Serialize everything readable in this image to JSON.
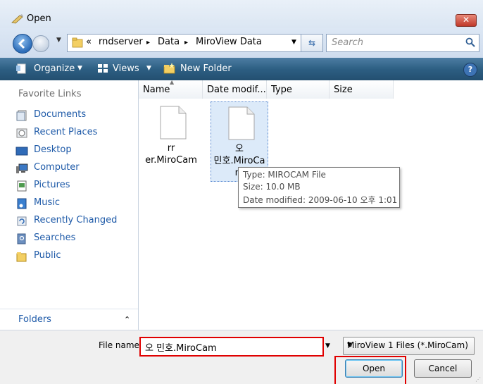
{
  "window": {
    "title": "Open",
    "close_glyph": "✕"
  },
  "address": {
    "overflow": "«",
    "crumbs": [
      "rndserver",
      "Data",
      "MiroView Data"
    ],
    "separator": "▸",
    "search_placeholder": "Search"
  },
  "toolbar": {
    "organize": "Organize",
    "views": "Views",
    "new_folder": "New Folder",
    "help": "?"
  },
  "sidebar": {
    "favorites_title": "Favorite Links",
    "items": [
      {
        "label": "Documents",
        "icon": "documents-icon"
      },
      {
        "label": "Recent Places",
        "icon": "recent-places-icon"
      },
      {
        "label": "Desktop",
        "icon": "desktop-icon"
      },
      {
        "label": "Computer",
        "icon": "computer-icon"
      },
      {
        "label": "Pictures",
        "icon": "pictures-icon"
      },
      {
        "label": "Music",
        "icon": "music-icon"
      },
      {
        "label": "Recently Changed",
        "icon": "recently-changed-icon"
      },
      {
        "label": "Searches",
        "icon": "searches-icon"
      },
      {
        "label": "Public",
        "icon": "public-folder-icon"
      }
    ],
    "folders_label": "Folders",
    "folders_chevron": "⌃"
  },
  "columns": [
    "Name",
    "Date modif...",
    "Type",
    "Size"
  ],
  "files": [
    {
      "line1": "rr",
      "line2": "er.MiroCam",
      "selected": false
    },
    {
      "line1": "오",
      "line2": "민호.MiroCa",
      "line3": "m",
      "selected": true
    }
  ],
  "tooltip": {
    "type": "Type: MIROCAM File",
    "size": "Size: 10.0 MB",
    "date": "Date modified: 2009-06-10 오후 1:01"
  },
  "bottom": {
    "file_name_label": "File name:",
    "file_name_value": "오 민호.MiroCam",
    "file_type": "MiroView 1 Files (*.MiroCam)",
    "open": "Open",
    "cancel": "Cancel"
  },
  "colors": {
    "accent": "#1e5aa8",
    "toolbar": "#2d5f83",
    "highlight": "#e00000",
    "selection": "#dceaf9"
  }
}
